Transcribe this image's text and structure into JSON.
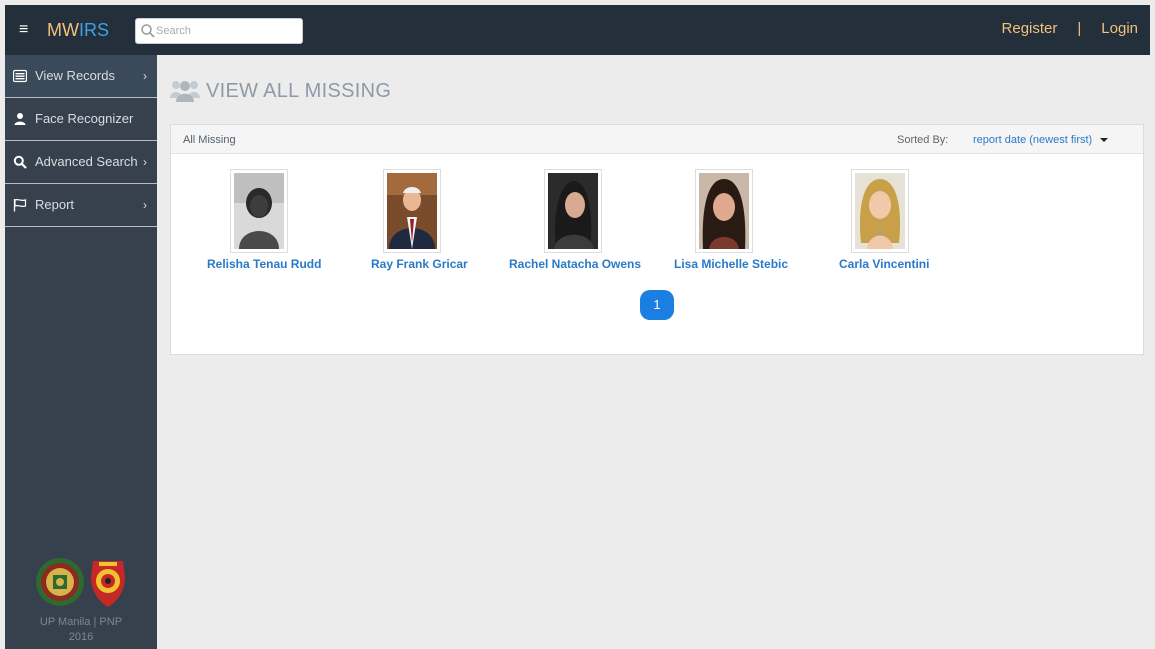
{
  "nav": {
    "menu_icon": "hamburger-icon",
    "brand_mw": "MW",
    "brand_irs": "IRS",
    "search_placeholder": "Search",
    "search_value": "",
    "register": "Register",
    "separator": "|",
    "login": "Login"
  },
  "sidebar": {
    "items": [
      {
        "label": "View Records",
        "icon": "list-icon",
        "chevron": "›"
      },
      {
        "label": "Face Recognizer",
        "icon": "user-icon",
        "chevron": ""
      },
      {
        "label": "Advanced Search",
        "icon": "search-icon",
        "chevron": "›"
      },
      {
        "label": "Report",
        "icon": "flag-icon",
        "chevron": "›"
      }
    ],
    "footer_line1": "UP Manila | PNP",
    "footer_line2": "2016"
  },
  "main": {
    "title": "VIEW ALL MISSING",
    "panel_title": "All Missing",
    "sort_label": "Sorted By:",
    "sort_value": "report date (newest first)",
    "records": [
      {
        "name": "Relisha Tenau Rudd"
      },
      {
        "name": "Ray Frank Gricar"
      },
      {
        "name": "Rachel Natacha Owens"
      },
      {
        "name": "Lisa Michelle Stebic"
      },
      {
        "name": "Carla Vincentini"
      }
    ],
    "pagination": {
      "current_page": "1"
    }
  },
  "colors": {
    "navbar": "#232f3b",
    "sidebar": "#36414d",
    "accent_link": "#2a7ac8",
    "brand_gold": "#f0c27b",
    "brand_blue": "#3ea1e6",
    "pager_active": "#1a7fe0"
  }
}
